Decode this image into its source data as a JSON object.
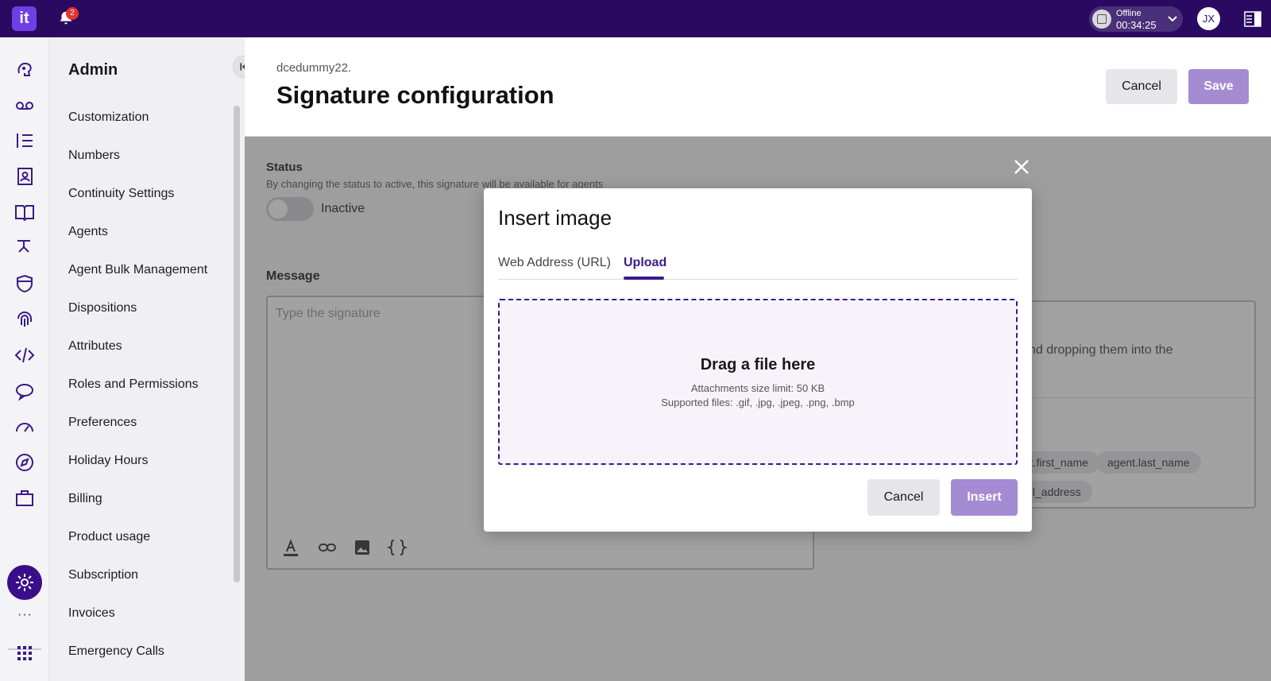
{
  "topbar": {
    "logo_text": "it",
    "notification_count": "2",
    "status_label": "Offline",
    "status_time": "00:34:25",
    "avatar_initials": "JX",
    "bar_color": "#2a0a61"
  },
  "rail": {
    "icons": [
      "head-icon",
      "voicemail-icon",
      "list-icon",
      "contact-book-icon",
      "book-icon",
      "routing-icon",
      "shield-icon",
      "fingerprint-icon",
      "code-icon",
      "chat-icon",
      "speedometer-icon",
      "compass-icon",
      "briefcase-icon",
      "gear-icon"
    ],
    "more": "···"
  },
  "sidebar": {
    "title": "Admin",
    "items": [
      {
        "label": "Customization"
      },
      {
        "label": "Numbers"
      },
      {
        "label": "Continuity Settings"
      },
      {
        "label": "Agents"
      },
      {
        "label": "Agent Bulk Management"
      },
      {
        "label": "Dispositions"
      },
      {
        "label": "Attributes"
      },
      {
        "label": "Roles and Permissions"
      },
      {
        "label": "Preferences"
      },
      {
        "label": "Holiday Hours"
      },
      {
        "label": "Billing"
      },
      {
        "label": "Product usage"
      },
      {
        "label": "Subscription"
      },
      {
        "label": "Invoices"
      },
      {
        "label": "Emergency Calls"
      }
    ]
  },
  "header": {
    "breadcrumb": "dcedummy22.",
    "title": "Signature configuration",
    "cancel_label": "Cancel",
    "save_label": "Save"
  },
  "form": {
    "status_title": "Status",
    "status_description": "By changing the status to active, this signature will be available for agents",
    "toggle_label": "Inactive",
    "toggle_on": false,
    "message_title": "Message",
    "editor_placeholder": "Type the signature",
    "vars_hint": "nd dropping them into the",
    "chips": [
      "nt.first_name",
      "agent.last_name",
      "ail_address"
    ]
  },
  "modal": {
    "title": "Insert image",
    "tabs": [
      {
        "label": "Web Address (URL)",
        "active": false
      },
      {
        "label": "Upload",
        "active": true
      }
    ],
    "dropzone_title": "Drag a file here",
    "dropzone_limit": "Attachments size limit: 50 KB",
    "dropzone_types": "Supported files: .gif, .jpg, .jpeg, .png, .bmp",
    "cancel_label": "Cancel",
    "insert_label": "Insert"
  },
  "colors": {
    "accent": "#3a1a8a",
    "primary_disabled": "#a48bd2"
  }
}
